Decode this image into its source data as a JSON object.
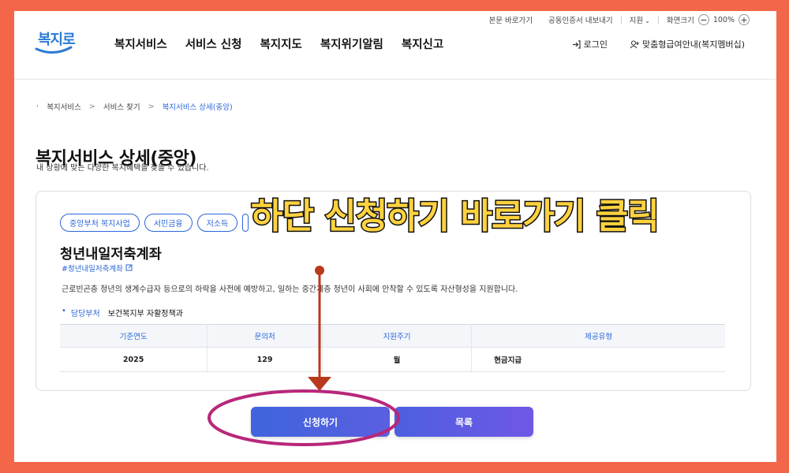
{
  "utility": {
    "skip_to_content": "본문 바로가기",
    "cert_export": "공동인증서 내보내기",
    "region": "지원",
    "screen_size_label": "화면크기",
    "zoom_minus": "−",
    "zoom_value": "100%",
    "zoom_plus": "+"
  },
  "logo": {
    "text": "복지로"
  },
  "gnb": [
    "복지서비스",
    "서비스 신청",
    "복지지도",
    "복지위기알림",
    "복지신고"
  ],
  "header_right": {
    "login": "로그인",
    "custom_info": "맞춤형급여안내(복지멤버십)"
  },
  "breadcrumb": [
    "복지서비스",
    "서비스 찾기",
    "복지서비스 상세(중앙)"
  ],
  "page": {
    "title": "복지서비스 상세(중앙)",
    "subtitle": "내 상황에 맞는 다양한 복지혜택을 찾을 수 있습니다."
  },
  "card": {
    "tags": [
      "중앙부처 복지사업",
      "서민금융",
      "저소득",
      ""
    ],
    "title": "청년내일저축계좌",
    "hashtag": "#청년내일저축계좌",
    "description": "근로빈곤층 청년의 생계수급자 등으로의 하락을 사전에 예방하고, 일하는 중간계층 청년이 사회에 안착할 수 있도록 자산형성을 지원합니다.",
    "dept_label": "담당부처",
    "dept_value": "보건복지부 자활정책과",
    "table": {
      "headers": [
        "기준연도",
        "문의처",
        "지원주기",
        "제공유형"
      ],
      "row": [
        "2025",
        "129",
        "월",
        "현금지급"
      ]
    }
  },
  "buttons": {
    "apply": "신청하기",
    "list": "목록"
  },
  "annotation": {
    "headline": "하단 신청하기 바로가기 클릭",
    "arrow_color": "#b83a1e",
    "circle_color": "#b8277a",
    "headline_color": "#ffd23f"
  },
  "colors": {
    "background": "#f4664a",
    "accent": "#2b66d9"
  }
}
